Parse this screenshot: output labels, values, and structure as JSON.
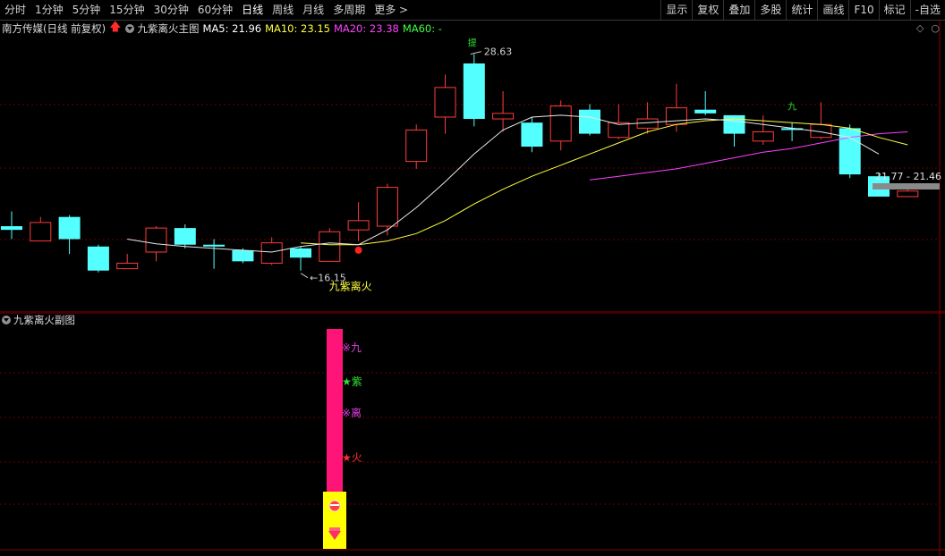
{
  "toolbar": {
    "left_items": [
      "分时",
      "1分钟",
      "5分钟",
      "15分钟",
      "30分钟",
      "60分钟",
      "日线",
      "周线",
      "月线",
      "多周期",
      "更多"
    ],
    "active": "日线",
    "more_arrow": ">",
    "right_items": [
      "显示",
      "复权",
      "叠加",
      "多股",
      "统计",
      "画线",
      "F10",
      "标记",
      "-自选"
    ]
  },
  "chart_header": {
    "stock": "南方传媒(日线 前复权)",
    "up_arrow_icon": "red-up-arrow",
    "indicator_name": "九紫离火主图",
    "ma5": "MA5: 21.96",
    "ma10": "MA10: 23.15",
    "ma20": "MA20: 23.38",
    "ma60": "MA60: -",
    "right_icons": [
      "◇",
      "○"
    ]
  },
  "annotations": {
    "high_price": "28.63",
    "low_price": "16.15",
    "signal_text": "九紫离火",
    "range_label": "21.77 - 21.46",
    "top_marker": "提",
    "jiu_marker": "九"
  },
  "sub_header": {
    "title": "九紫离火副图"
  },
  "sub_labels": [
    {
      "text": "※九",
      "color": "#e040e0"
    },
    {
      "text": "★紫",
      "color": "#30e030"
    },
    {
      "text": "※离",
      "color": "#e040e0"
    },
    {
      "text": "★火",
      "color": "#ff3030"
    }
  ],
  "colors": {
    "up": "#ff3c3c",
    "down": "#54ffff",
    "ma5": "#ffffff",
    "ma10": "#ffff40",
    "ma20": "#ff40ff",
    "ma60": "#40ff40",
    "grid": "#6a0000",
    "bar": "#ff1478",
    "badge": "#ffff00"
  },
  "chart_data": {
    "type": "candlestick",
    "candles": [
      {
        "o": 19.3,
        "c": 19.1,
        "h": 20.1,
        "l": 18.6
      },
      {
        "o": 18.5,
        "c": 19.5,
        "h": 19.8,
        "l": 18.5
      },
      {
        "o": 19.8,
        "c": 18.6,
        "h": 19.9,
        "l": 17.8
      },
      {
        "o": 18.2,
        "c": 16.9,
        "h": 18.3,
        "l": 16.8
      },
      {
        "o": 17.0,
        "c": 17.3,
        "h": 17.8,
        "l": 17.0
      },
      {
        "o": 17.9,
        "c": 19.2,
        "h": 19.3,
        "l": 17.4
      },
      {
        "o": 19.2,
        "c": 18.3,
        "h": 19.4,
        "l": 18.1
      },
      {
        "o": 18.3,
        "c": 18.2,
        "h": 18.6,
        "l": 17.0
      },
      {
        "o": 18.0,
        "c": 17.4,
        "h": 18.1,
        "l": 17.3
      },
      {
        "o": 17.3,
        "c": 18.4,
        "h": 18.7,
        "l": 17.2
      },
      {
        "o": 18.1,
        "c": 17.6,
        "h": 18.2,
        "l": 16.9
      },
      {
        "o": 17.4,
        "c": 19.0,
        "h": 19.2,
        "l": 17.4
      },
      {
        "o": 19.1,
        "c": 19.6,
        "h": 20.6,
        "l": 18.5
      },
      {
        "o": 19.3,
        "c": 21.4,
        "h": 21.6,
        "l": 18.8
      },
      {
        "o": 22.8,
        "c": 24.5,
        "h": 24.8,
        "l": 22.4
      },
      {
        "o": 25.2,
        "c": 26.8,
        "h": 27.5,
        "l": 24.3
      },
      {
        "o": 28.1,
        "c": 25.1,
        "h": 28.6,
        "l": 24.7
      },
      {
        "o": 25.1,
        "c": 25.4,
        "h": 26.6,
        "l": 24.4
      },
      {
        "o": 24.9,
        "c": 23.6,
        "h": 25.2,
        "l": 23.3
      },
      {
        "o": 23.9,
        "c": 25.8,
        "h": 26.1,
        "l": 23.4
      },
      {
        "o": 25.6,
        "c": 24.3,
        "h": 25.9,
        "l": 24.2
      },
      {
        "o": 24.1,
        "c": 24.9,
        "h": 25.9,
        "l": 24.0
      },
      {
        "o": 24.6,
        "c": 25.1,
        "h": 26.0,
        "l": 24.3
      },
      {
        "o": 24.8,
        "c": 25.7,
        "h": 27.0,
        "l": 24.4
      },
      {
        "o": 25.6,
        "c": 25.4,
        "h": 26.6,
        "l": 25.3
      },
      {
        "o": 25.3,
        "c": 24.3,
        "h": 25.3,
        "l": 23.6
      },
      {
        "o": 23.9,
        "c": 24.4,
        "h": 25.3,
        "l": 23.7
      },
      {
        "o": 24.6,
        "c": 24.5,
        "h": 24.9,
        "l": 23.9
      },
      {
        "o": 24.1,
        "c": 24.8,
        "h": 26.0,
        "l": 24.0
      },
      {
        "o": 24.6,
        "c": 22.1,
        "h": 24.8,
        "l": 21.9
      },
      {
        "o": 22.0,
        "c": 20.9,
        "h": 22.2,
        "l": 20.9
      },
      {
        "o": 20.9,
        "c": 21.2,
        "h": 21.5,
        "l": 20.9
      }
    ],
    "ma5": [
      null,
      null,
      null,
      null,
      18.6,
      18.35,
      18.2,
      18.1,
      18.0,
      17.9,
      18.2,
      18.4,
      18.3,
      19.1,
      20.3,
      21.7,
      23.2,
      24.5,
      25.2,
      25.3,
      25.2,
      24.8,
      24.9,
      25.0,
      25.1,
      25.0,
      24.8,
      24.6,
      24.4,
      24.1,
      23.2
    ],
    "ma10": [
      null,
      null,
      null,
      null,
      null,
      null,
      null,
      null,
      null,
      null,
      18.4,
      18.3,
      18.3,
      18.5,
      18.9,
      19.6,
      20.5,
      21.3,
      22.0,
      22.6,
      23.2,
      23.8,
      24.4,
      24.8,
      25.0,
      25.1,
      25.0,
      24.9,
      24.8,
      24.6,
      24.1,
      23.7
    ],
    "ma20": [
      null,
      null,
      null,
      null,
      null,
      null,
      null,
      null,
      null,
      null,
      null,
      null,
      null,
      null,
      null,
      null,
      null,
      null,
      null,
      null,
      21.8,
      22.0,
      22.2,
      22.4,
      22.7,
      23.0,
      23.3,
      23.5,
      23.8,
      24.1,
      24.3,
      24.4
    ],
    "y_range": [
      15.0,
      29.5
    ],
    "signal_index": 12,
    "sub_bar_index": 11
  }
}
